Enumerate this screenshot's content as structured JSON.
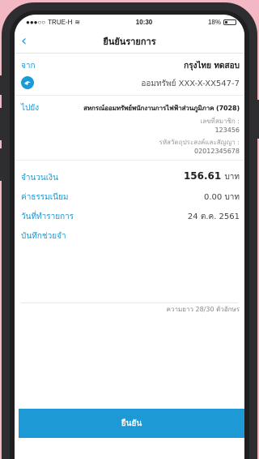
{
  "status_bar": {
    "carrier": "TRUE-H",
    "time": "10:30",
    "battery": "18%"
  },
  "nav": {
    "title": "ยืนยันรายการ"
  },
  "from": {
    "label": "จาก",
    "name": "กรุงไทย ทดสอบ",
    "account": "ออมทรัพย์ XXX-X-XX547-7"
  },
  "to": {
    "label": "ไปยัง",
    "name": "สหกรณ์ออมทรัพย์พนักงานการไฟฟ้าส่วนภูมิภาค (7028)",
    "ref1_label": "เลขที่สมาชิก :",
    "ref1_value": "123456",
    "ref2_label": "รหัสวัตถุประสงค์และสัญญา :",
    "ref2_value": "02012345678"
  },
  "amount": {
    "label": "จำนวนเงิน",
    "value": "156.61",
    "unit": "บาท"
  },
  "fee": {
    "label": "ค่าธรรมเนียม",
    "value": "0.00 บาท"
  },
  "date": {
    "label": "วันที่ทำรายการ",
    "value": "24 ต.ค. 2561"
  },
  "memo": {
    "label": "บันทึกช่วยจำ",
    "counter": "ความยาว 28/30 ตัวอักษร"
  },
  "confirm_label": "ยืนยัน",
  "colors": {
    "accent": "#1a9ad6",
    "background": "#f4b8c5"
  }
}
